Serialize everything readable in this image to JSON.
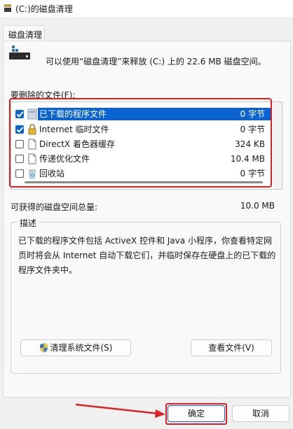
{
  "window": {
    "title": "(C:)的磁盘清理"
  },
  "tab": {
    "label": "磁盘清理"
  },
  "info": {
    "text": "可以使用“磁盘清理”来释放  (C:)  上的 22.6 MB 磁盘空间。"
  },
  "files": {
    "label": "要删除的文件(F):",
    "items": [
      {
        "name": "已下载的程序文件",
        "size": "0 字节",
        "checked": true,
        "selected": true,
        "icon": "folder-icon"
      },
      {
        "name": "Internet 临时文件",
        "size": "0 字节",
        "checked": true,
        "selected": false,
        "icon": "lock-icon"
      },
      {
        "name": "DirectX 着色器缓存",
        "size": "324 KB",
        "checked": false,
        "selected": false,
        "icon": "document-icon"
      },
      {
        "name": "传递优化文件",
        "size": "10.4 MB",
        "checked": false,
        "selected": false,
        "icon": "document-icon"
      },
      {
        "name": "回收站",
        "size": "0 字节",
        "checked": false,
        "selected": false,
        "icon": "recycle-bin-icon"
      }
    ]
  },
  "total": {
    "label": "可获得的磁盘空间总量:",
    "value": "10.0 MB"
  },
  "description": {
    "title": "描述",
    "text": "已下载的程序文件包括 ActiveX 控件和 Java 小程序，你查看特定网页时将会从 Internet 自动下载它们，并临时保存在硬盘上的已下载的程序文件夹中。"
  },
  "buttons": {
    "cleanup_system": "清理系统文件(S)",
    "view_files": "查看文件(V)",
    "ok": "确定",
    "cancel": "取消"
  },
  "colors": {
    "accent": "#0b62d1",
    "annotation": "#e02020"
  }
}
